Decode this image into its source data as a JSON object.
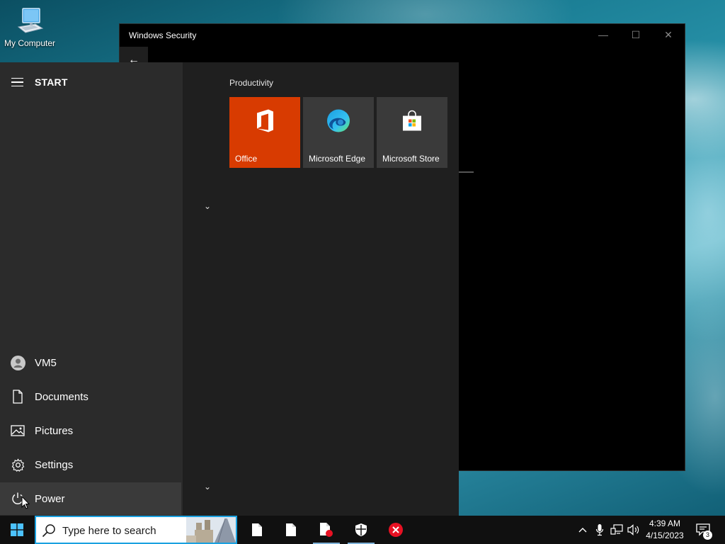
{
  "desktop": {
    "icons": [
      {
        "label": "My Computer",
        "icon": "computer-icon"
      }
    ]
  },
  "security_window": {
    "title": "Windows Security",
    "controls": {
      "minimize": "—",
      "maximize": "☐",
      "close": "✕"
    },
    "back_glyph": "←"
  },
  "start_menu": {
    "title": "START",
    "left_items": [
      {
        "label": "VM5",
        "icon": "user-avatar-icon"
      },
      {
        "label": "Documents",
        "icon": "document-icon"
      },
      {
        "label": "Pictures",
        "icon": "pictures-icon"
      },
      {
        "label": "Settings",
        "icon": "gear-icon"
      },
      {
        "label": "Power",
        "icon": "power-icon"
      }
    ],
    "group": {
      "label": "Productivity",
      "tiles": [
        {
          "label": "Office",
          "icon": "office-icon",
          "color": "#d83b01"
        },
        {
          "label": "Microsoft Edge",
          "icon": "edge-icon",
          "color": "#3a3a3a"
        },
        {
          "label": "Microsoft Store",
          "icon": "store-icon",
          "color": "#3a3a3a"
        }
      ]
    },
    "expand_glyph": "⌄"
  },
  "taskbar": {
    "search_placeholder": "Type here to search",
    "apps": [
      "file-icon",
      "file-icon",
      "file-recording-icon",
      "shield-icon",
      "error-close-icon"
    ],
    "tray_icons": [
      "chevron-up-icon",
      "microphone-icon",
      "network-icon",
      "speaker-icon"
    ],
    "time": "4:39 AM",
    "date": "4/15/2023",
    "notification_count": "3"
  },
  "colors": {
    "accent": "#1aa1e0",
    "office_tile": "#d83b01",
    "start_left_bg": "#2b2b2b",
    "start_right_bg": "#1f1f1f"
  }
}
